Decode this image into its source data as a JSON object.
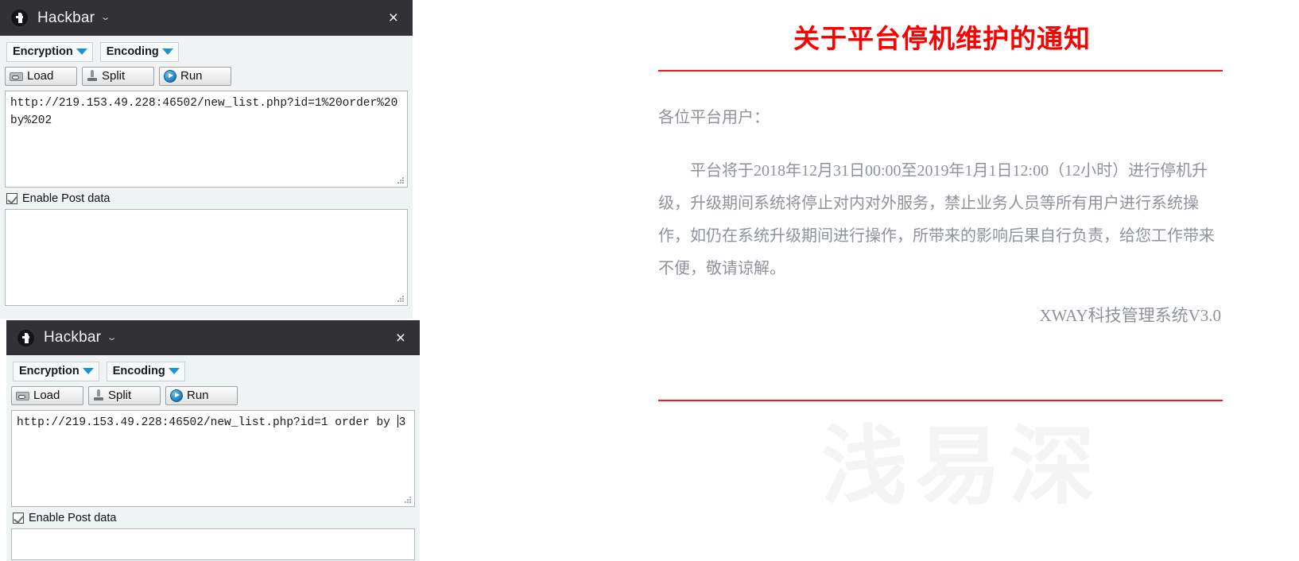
{
  "windows": [
    {
      "id": "hackbar-1",
      "title": "Hackbar",
      "chevron": "⌄",
      "close": "×",
      "buttons": {
        "encryption": "Encryption",
        "encoding": "Encoding",
        "load": "Load",
        "split": "Split",
        "run": "Run"
      },
      "url_value": "http://219.153.49.228:46502/new_list.php?id=1%20order%20by%202",
      "post_checkbox_label": "Enable Post data",
      "post_checked": true,
      "post_value": ""
    },
    {
      "id": "hackbar-2",
      "title": "Hackbar",
      "chevron": "⌄",
      "close": "×",
      "buttons": {
        "encryption": "Encryption",
        "encoding": "Encoding",
        "load": "Load",
        "split": "Split",
        "run": "Run"
      },
      "url_value_before_caret": "http://219.153.49.228:46502/new_list.php?id=1 order by ",
      "url_value_after_caret": "3",
      "url_value": "http://219.153.49.228:46502/new_list.php?id=1 order by 3",
      "post_checkbox_label": "Enable Post data",
      "post_checked": true,
      "post_value": ""
    }
  ],
  "notice": {
    "title": "关于平台停机维护的通知",
    "salutation": "各位平台用户：",
    "body": "平台将于2018年12月31日00:00至2019年1月1日12:00（12小时）进行停机升级，升级期间系统将停止对内对外服务，禁止业务人员等所有用户进行系统操作，如仍在系统升级期间进行操作，所带来的影响后果自行负责，给您工作带来不便，敬请谅解。",
    "signature": "XWAY科技管理系统V3.0",
    "watermark": "浅易深",
    "colors": {
      "title_red": "#fc0000",
      "rule_red": "#f71919",
      "body_gray": "#8e9299",
      "watermark_gray": "#f4f4f4"
    }
  }
}
